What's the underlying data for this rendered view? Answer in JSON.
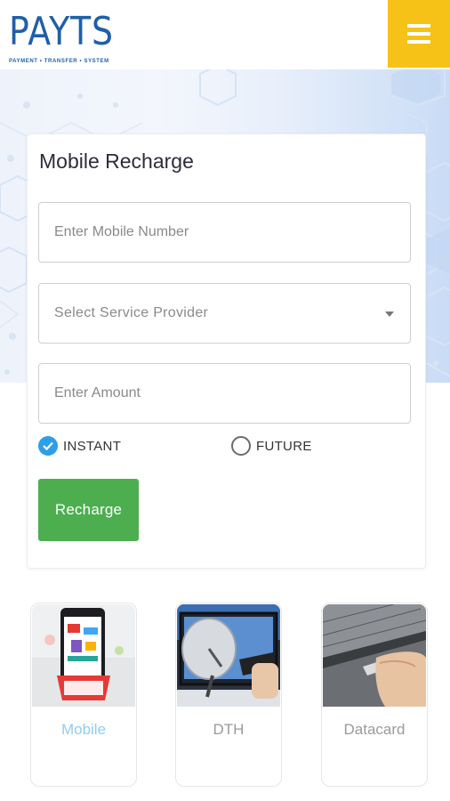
{
  "brand": {
    "logo_text": "PAYTS",
    "logo_subtitle": "PAYMENT • TRANSFER • SYSTEM",
    "color": "#1f5fa8"
  },
  "header": {
    "menu_icon": "hamburger-menu-icon",
    "menu_color": "#f7c218"
  },
  "form": {
    "title": "Mobile Recharge",
    "mobile_placeholder": "Enter Mobile Number",
    "provider_placeholder": "Select Service Provider",
    "amount_placeholder": "Enter Amount",
    "options": [
      {
        "label": "INSTANT",
        "selected": true
      },
      {
        "label": "FUTURE",
        "selected": false
      }
    ],
    "submit_label": "Recharge",
    "submit_color": "#4cae4f",
    "radio_color": "#2d9ee8"
  },
  "services": [
    {
      "label": "Mobile",
      "icon": "mobile-phone-image",
      "active": true
    },
    {
      "label": "DTH",
      "icon": "satellite-dish-image",
      "active": false
    },
    {
      "label": "Datacard",
      "icon": "usb-datacard-image",
      "active": false
    }
  ]
}
